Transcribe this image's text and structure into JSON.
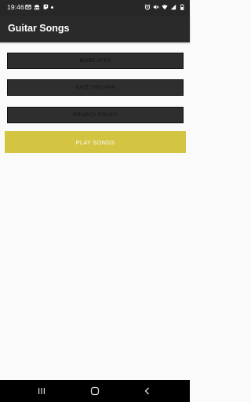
{
  "status_bar": {
    "time": "19:46",
    "left_icons": [
      "gmail-icon",
      "incognito-icon",
      "twitch-icon",
      "dot-icon"
    ],
    "right_icons": [
      "alarm-icon",
      "mute-icon",
      "wifi-icon",
      "signal-icon",
      "battery-icon"
    ]
  },
  "app_bar": {
    "title": "Guitar Songs"
  },
  "menu": {
    "more_apps": "MORE APPS",
    "rate_app": "RATE THIS APP",
    "privacy_policy": "PRIVACY POLICY",
    "play_songs": "PLAY SONGS"
  },
  "nav_bar": {
    "icons": [
      "recents-icon",
      "home-icon",
      "back-icon"
    ]
  },
  "colors": {
    "app_bar": "#2a2a2a",
    "status_bar": "#272727",
    "dark_button": "#2e2e2e",
    "accent_button": "#d3c441",
    "background": "#fafafa"
  }
}
